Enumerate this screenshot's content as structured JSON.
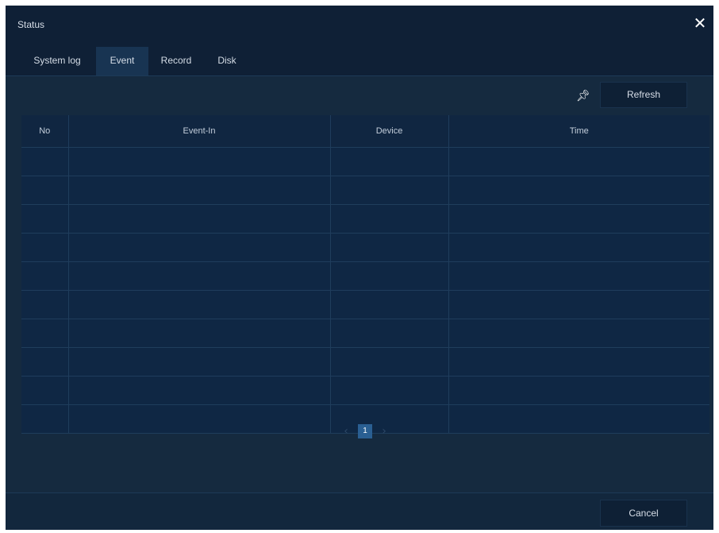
{
  "dialog": {
    "title": "Status"
  },
  "tabs": [
    {
      "label": "System log",
      "active": false
    },
    {
      "label": "Event",
      "active": true
    },
    {
      "label": "Record",
      "active": false
    },
    {
      "label": "Disk",
      "active": false
    }
  ],
  "toolbar": {
    "pin_icon": "pin-icon",
    "refresh_label": "Refresh"
  },
  "table": {
    "columns": [
      "No",
      "Event-In",
      "Device",
      "Time"
    ],
    "rows": [
      [
        "",
        "",
        "",
        ""
      ],
      [
        "",
        "",
        "",
        ""
      ],
      [
        "",
        "",
        "",
        ""
      ],
      [
        "",
        "",
        "",
        ""
      ],
      [
        "",
        "",
        "",
        ""
      ],
      [
        "",
        "",
        "",
        ""
      ],
      [
        "",
        "",
        "",
        ""
      ],
      [
        "",
        "",
        "",
        ""
      ],
      [
        "",
        "",
        "",
        ""
      ],
      [
        "",
        "",
        "",
        ""
      ]
    ]
  },
  "pagination": {
    "current_page": "1",
    "prev_icon": "chevron-left-icon",
    "next_icon": "chevron-right-icon"
  },
  "footer": {
    "cancel_label": "Cancel"
  },
  "colors": {
    "background": "#152a3f",
    "header": "#0f2036",
    "table_cell": "#0f2744",
    "accent": "#2a5f92"
  }
}
